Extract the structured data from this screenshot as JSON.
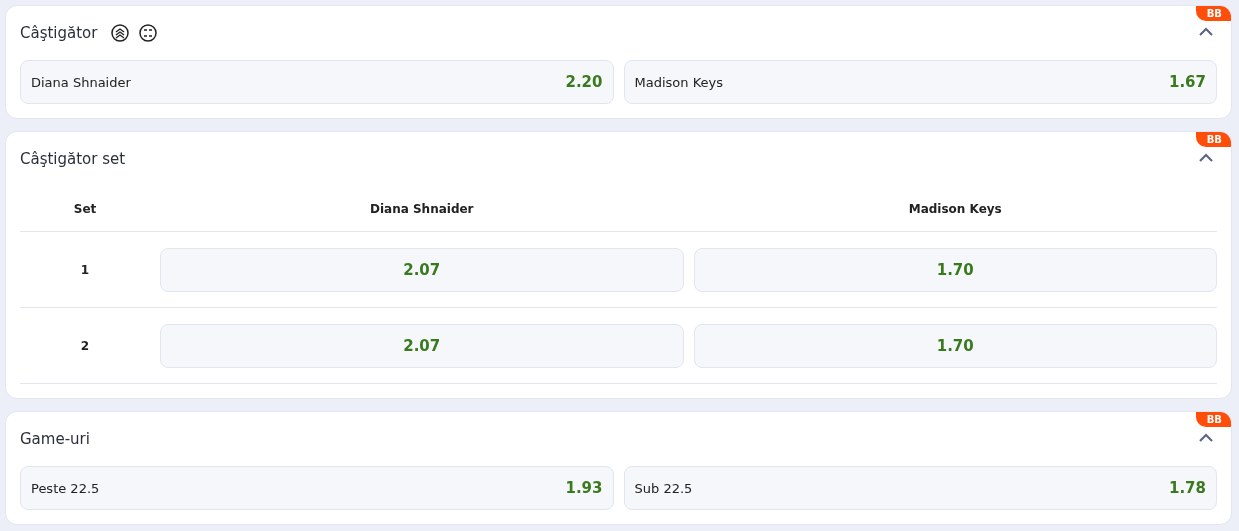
{
  "markets": [
    {
      "kind": "options",
      "title": "Câştigător",
      "badge": "BB",
      "expanded": true,
      "icons": true,
      "options": [
        {
          "label": "Diana Shnaider",
          "odds": "2.20"
        },
        {
          "label": "Madison Keys",
          "odds": "1.67"
        }
      ]
    },
    {
      "kind": "table",
      "title": "Câştigător set",
      "badge": "BB",
      "expanded": true,
      "columns": [
        "Set",
        "Diana Shnaider",
        "Madison Keys"
      ],
      "rows": [
        {
          "set": "1",
          "odds": [
            "2.07",
            "1.70"
          ]
        },
        {
          "set": "2",
          "odds": [
            "2.07",
            "1.70"
          ]
        }
      ]
    },
    {
      "kind": "options",
      "title": "Game-uri",
      "badge": "BB",
      "expanded": true,
      "icons": false,
      "options": [
        {
          "label": "Peste 22.5",
          "odds": "1.93"
        },
        {
          "label": "Sub 22.5",
          "odds": "1.78"
        }
      ]
    }
  ]
}
